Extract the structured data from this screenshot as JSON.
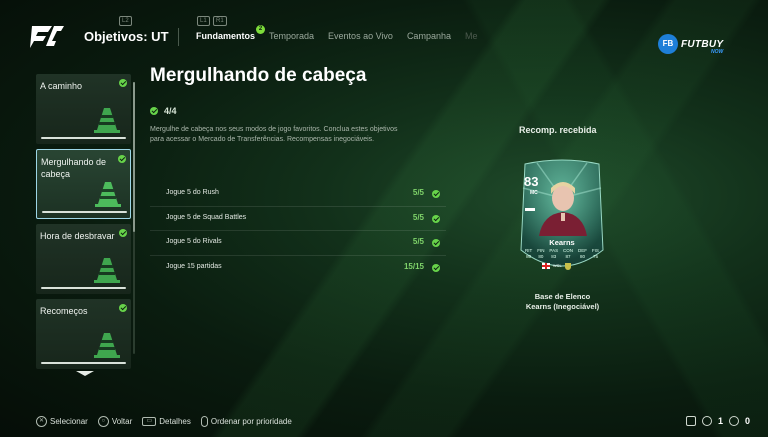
{
  "header": {
    "title": "Objetivos: UT",
    "tabs": [
      {
        "label": "Fundamentos",
        "active": true,
        "badge": "2"
      },
      {
        "label": "Temporada",
        "active": false
      },
      {
        "label": "Eventos ao Vivo",
        "active": false
      },
      {
        "label": "Campanha",
        "active": false
      },
      {
        "label": "Me",
        "active": false
      }
    ],
    "button_hints": {
      "left": "L2",
      "l1": "L1",
      "r1": "R1"
    },
    "brand": {
      "badge": "FB",
      "name": "FUTBUY",
      "sub": "NOW"
    }
  },
  "sidebar": {
    "items": [
      {
        "label": "A caminho",
        "completed": true,
        "selected": false
      },
      {
        "label": "Mergulhando de cabeça",
        "completed": true,
        "selected": true
      },
      {
        "label": "Hora de desbravar",
        "completed": true,
        "selected": false
      },
      {
        "label": "Recomeços",
        "completed": true,
        "selected": false
      }
    ]
  },
  "main": {
    "title": "Mergulhando de cabeça",
    "progress": "4/4",
    "description": "Mergulhe de cabeça nos seus modos de jogo favoritos. Conclua estes objetivos para acessar o Mercado de Transferências. Recompensas inegociáveis.",
    "objectives": [
      {
        "label": "Jogue 5 do Rush",
        "value": "5/5"
      },
      {
        "label": "Jogue 5 de Squad Battles",
        "value": "5/5"
      },
      {
        "label": "Jogue 5 do Rivals",
        "value": "5/5"
      },
      {
        "label": "Jogue 15 partidas",
        "value": "15/15"
      }
    ]
  },
  "reward": {
    "title": "Recomp. recebida",
    "card": {
      "rating": "83",
      "position": "MC",
      "name": "Kearns",
      "stats": [
        {
          "label": "RIT",
          "value": "80"
        },
        {
          "label": "FIN",
          "value": "80"
        },
        {
          "label": "PAS",
          "value": "83"
        },
        {
          "label": "CON",
          "value": "87"
        },
        {
          "label": "DEF",
          "value": "80"
        },
        {
          "label": "FIS",
          "value": "75"
        }
      ],
      "league_mark": "WSL"
    },
    "caption_line1": "Base de Elenco",
    "caption_line2": "Kearns (Inegociável)"
  },
  "footer": {
    "actions": [
      {
        "icon": "cross-button-icon",
        "glyph": "✕",
        "label": "Selecionar"
      },
      {
        "icon": "circle-button-icon",
        "glyph": "○",
        "label": "Voltar"
      },
      {
        "icon": "touchpad-icon",
        "glyph": "▭",
        "label": "Detalhes"
      },
      {
        "icon": "r3-button-icon",
        "glyph": "",
        "label": "Ordenar por prioridade"
      }
    ],
    "status": [
      {
        "icon": "inbox-icon",
        "value": ""
      },
      {
        "icon": "notification-icon",
        "value": "1"
      },
      {
        "icon": "friends-icon",
        "value": "0"
      }
    ]
  },
  "colors": {
    "accent_green": "#67d34a",
    "selection_border": "#9dd6e6",
    "brand_blue": "#1e7fd8"
  }
}
